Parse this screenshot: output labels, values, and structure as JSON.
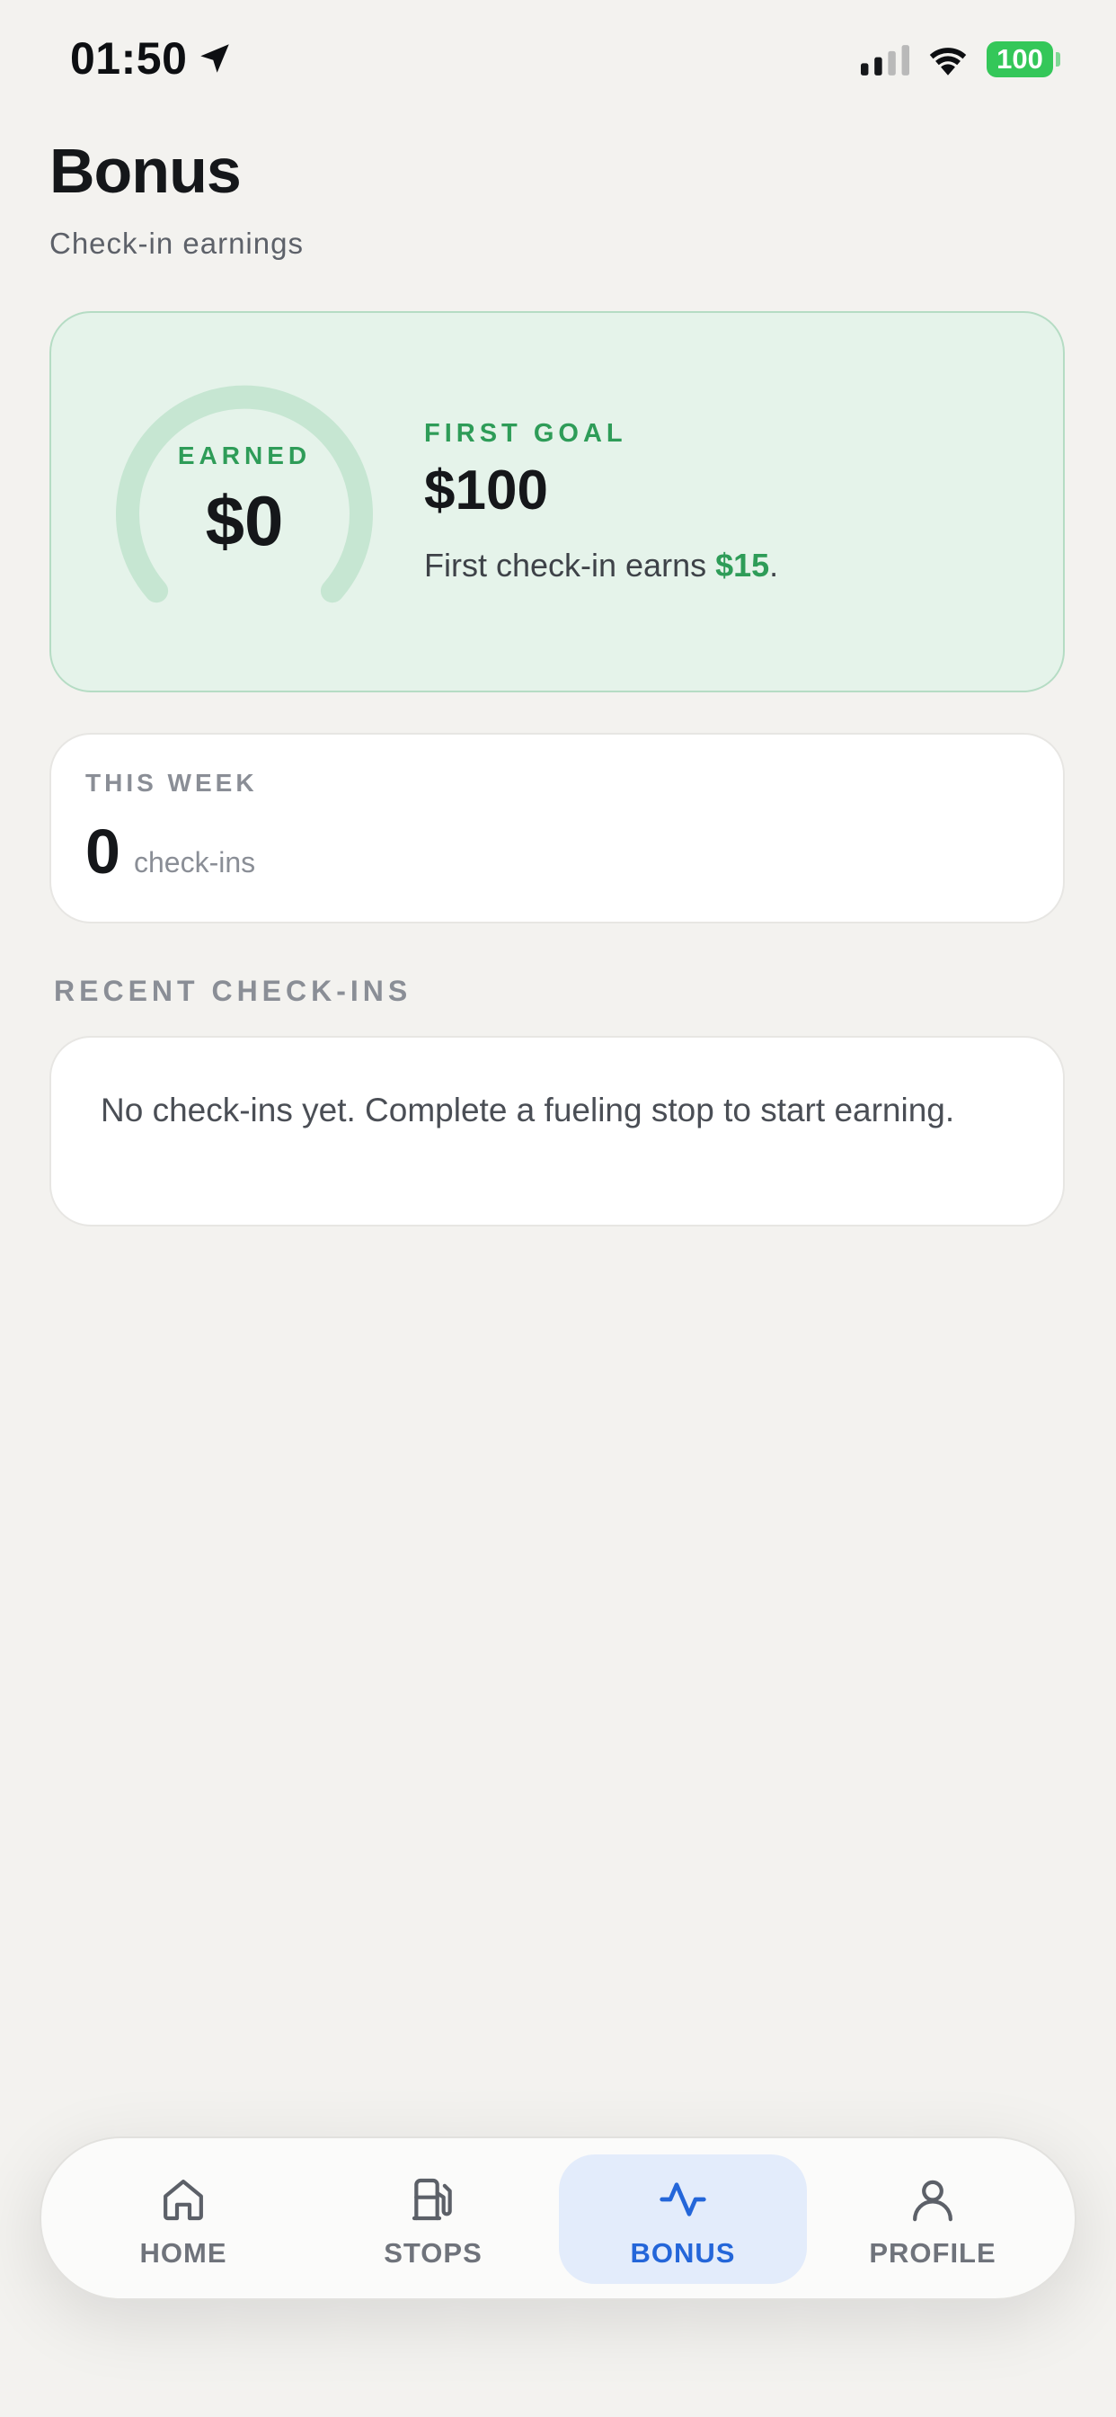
{
  "status_bar": {
    "time": "01:50",
    "battery": "100",
    "battery_color": "#34c759"
  },
  "header": {
    "title": "Bonus",
    "subtitle": "Check-in earnings"
  },
  "earnings_card": {
    "gauge_label": "EARNED",
    "earned_value": "$0",
    "goal_label": "FIRST GOAL",
    "goal_value": "$100",
    "note_prefix": "First check-in earns ",
    "note_amount": "$15",
    "note_suffix": ".",
    "progress_fraction": 0,
    "accent_color": "#2e9c58"
  },
  "week_card": {
    "label": "THIS WEEK",
    "count": "0",
    "unit": "check-ins"
  },
  "recent": {
    "heading": "RECENT CHECK-INS",
    "empty_message": "No check-ins yet. Complete a fueling stop to start earning."
  },
  "tabs": [
    {
      "label": "HOME",
      "icon": "home-icon",
      "active": false
    },
    {
      "label": "STOPS",
      "icon": "fuel-pump-icon",
      "active": false
    },
    {
      "label": "BONUS",
      "icon": "activity-icon",
      "active": true
    },
    {
      "label": "PROFILE",
      "icon": "user-icon",
      "active": false
    }
  ],
  "colors": {
    "active_tab": "#2466d9",
    "active_tab_bg": "#e3ecfb"
  }
}
